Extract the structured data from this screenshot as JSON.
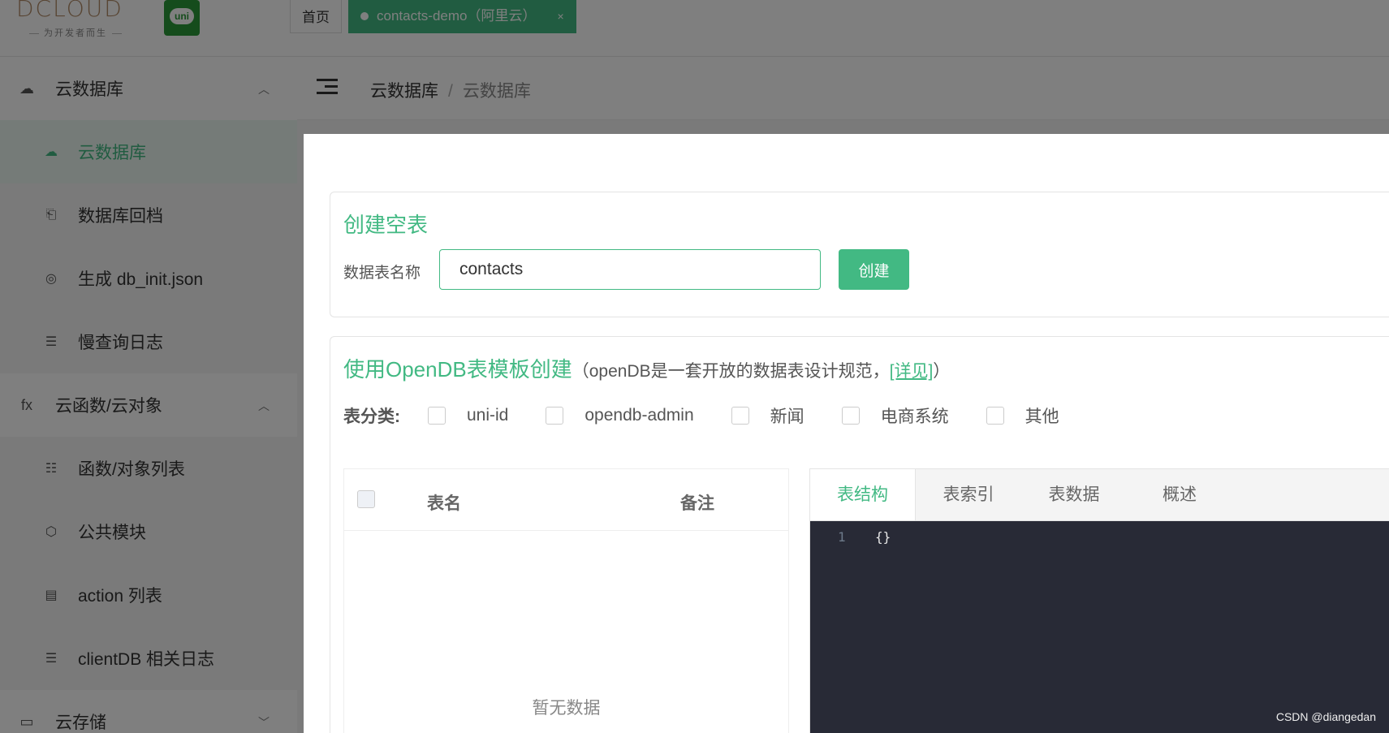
{
  "header": {
    "logo_text": "DCLOUD",
    "logo_tagline": "为开发者而生",
    "uni_logo": "uni",
    "tabs": [
      {
        "label": "首页"
      },
      {
        "label": "contacts-demo（阿里云）",
        "close": "×"
      }
    ]
  },
  "sidebar": {
    "groups": [
      {
        "label": "云数据库",
        "icon": "cloud-db-icon",
        "chevron": "︿"
      },
      {
        "label": "云函数/云对象",
        "icon": "fx-icon",
        "icon_text": "fx",
        "chevron": "︿"
      },
      {
        "label": "云存储",
        "icon": "storage-icon",
        "chevron": "﹀"
      }
    ],
    "db_items": [
      {
        "label": "云数据库",
        "icon": "cloud-db-icon"
      },
      {
        "label": "数据库回档",
        "icon": "rollback-icon"
      },
      {
        "label": "生成 db_init.json",
        "icon": "generate-icon"
      },
      {
        "label": "慢查询日志",
        "icon": "log-icon"
      }
    ],
    "fn_items": [
      {
        "label": "函数/对象列表",
        "icon": "list-icon"
      },
      {
        "label": "公共模块",
        "icon": "cube-icon"
      },
      {
        "label": "action 列表",
        "icon": "action-icon"
      },
      {
        "label": "clientDB 相关日志",
        "icon": "log-icon"
      }
    ]
  },
  "breadcrumb": {
    "root": "云数据库",
    "sep": "/",
    "current": "云数据库"
  },
  "create_card": {
    "title": "创建空表",
    "field_label": "数据表名称",
    "input_value": "contacts",
    "button": "创建"
  },
  "opendb_card": {
    "title": "使用OpenDB表模板创建",
    "desc_prefix": "（openDB是一套开放的数据表设计规范，",
    "link": "[详见]",
    "desc_suffix": "）",
    "category_label": "表分类:",
    "categories": [
      "uni-id",
      "opendb-admin",
      "新闻",
      "电商系统",
      "其他"
    ],
    "table": {
      "col_name": "表名",
      "col_note": "备注",
      "empty": "暂无数据"
    },
    "editor": {
      "tabs": [
        "表结构",
        "表索引",
        "表数据",
        "概述"
      ],
      "line_no": "1",
      "code": "{}"
    }
  },
  "watermark": "CSDN @diangedan",
  "colors": {
    "accent": "#42b983",
    "editor_bg": "#282a36",
    "overlay": "rgba(0,0,0,0.5)"
  }
}
